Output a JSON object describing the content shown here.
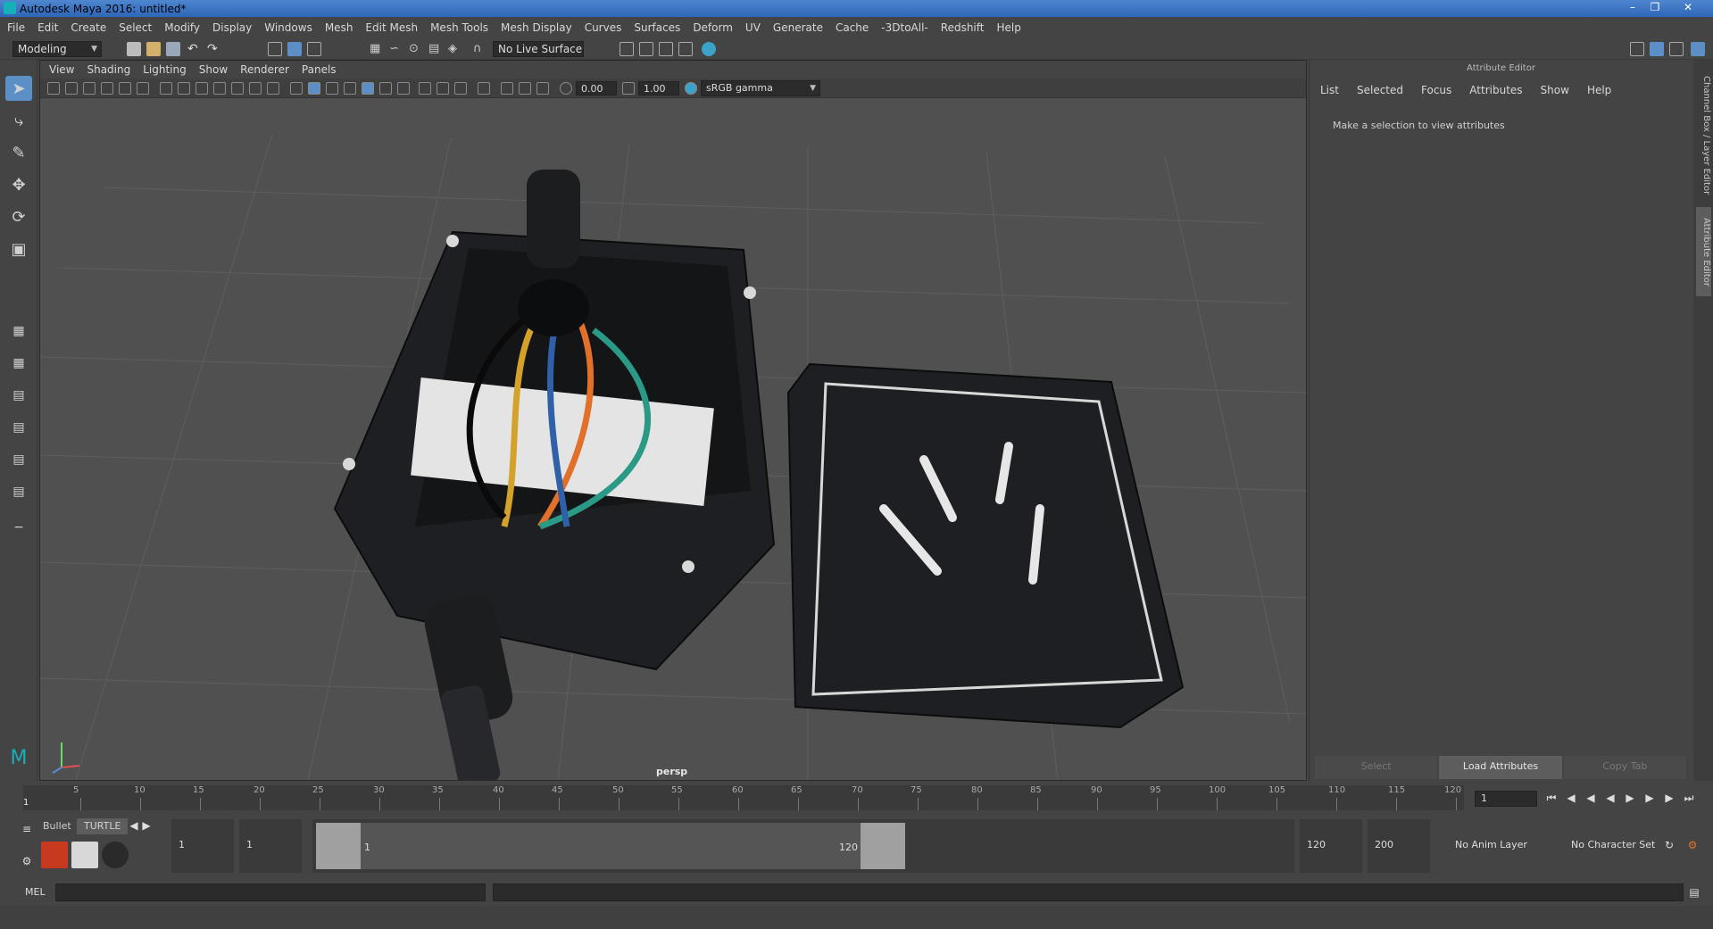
{
  "window": {
    "title": "Autodesk Maya 2016: untitled*"
  },
  "menubar": [
    "File",
    "Edit",
    "Create",
    "Select",
    "Modify",
    "Display",
    "Windows",
    "Mesh",
    "Edit Mesh",
    "Mesh Tools",
    "Mesh Display",
    "Curves",
    "Surfaces",
    "Deform",
    "UV",
    "Generate",
    "Cache",
    "-3DtoAll-",
    "Redshift",
    "Help"
  ],
  "statusline": {
    "mode": "Modeling",
    "live_surface": "No Live Surface"
  },
  "viewport": {
    "menus": [
      "View",
      "Shading",
      "Lighting",
      "Show",
      "Renderer",
      "Panels"
    ],
    "exposure": "0.00",
    "gamma": "1.00",
    "color_space": "sRGB gamma",
    "camera": "persp"
  },
  "attribute_editor": {
    "title": "Attribute Editor",
    "menus": [
      "List",
      "Selected",
      "Focus",
      "Attributes",
      "Show",
      "Help"
    ],
    "message": "Make a selection to view attributes",
    "buttons": [
      "Select",
      "Load Attributes",
      "Copy Tab"
    ]
  },
  "side_tabs": [
    "Channel Box / Layer Editor",
    "Attribute Editor"
  ],
  "timeline": {
    "ticks": [
      "5",
      "10",
      "15",
      "20",
      "25",
      "30",
      "35",
      "40",
      "45",
      "50",
      "55",
      "60",
      "65",
      "70",
      "75",
      "80",
      "85",
      "90",
      "95",
      "100",
      "105",
      "110",
      "115",
      "120"
    ],
    "start_label": "1",
    "current_frame": "1"
  },
  "range": {
    "shelf_tabs": [
      "Bullet",
      "TURTLE"
    ],
    "start": "1",
    "anim_start": "1",
    "range_start": "1",
    "range_end": "120",
    "anim_end": "120",
    "end": "200",
    "anim_layer": "No Anim Layer",
    "character_set": "No Character Set"
  },
  "cmdline": {
    "label": "MEL"
  },
  "colors": {
    "accent": "#5b8fc6",
    "title_bar": "#3a72c2",
    "viewport_bg": "#4d4d4d"
  }
}
